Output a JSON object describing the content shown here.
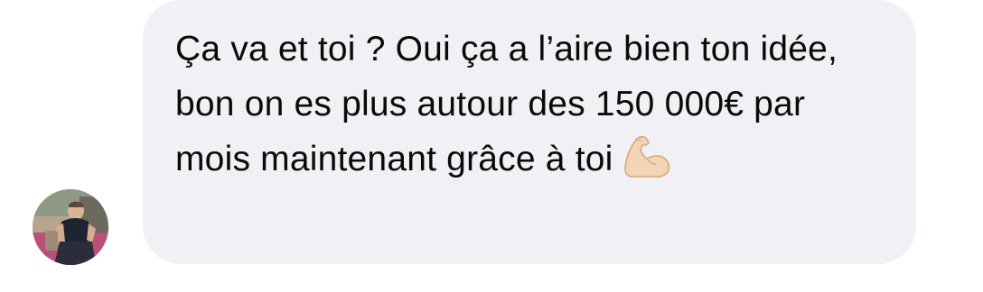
{
  "conversation": {
    "message": {
      "text": "Ça va et toi ? Oui ça a l’aire bien ton idée, bon on es plus autour des 150 000€ par mois maintenant grâce à toi",
      "emoji": "flexed-biceps-emoji"
    },
    "sender": {
      "avatar_icon": "profile-photo"
    }
  },
  "colors": {
    "bubble_background": "#f0f1f4",
    "text": "#0a0a0a",
    "page_background": "#ffffff"
  }
}
